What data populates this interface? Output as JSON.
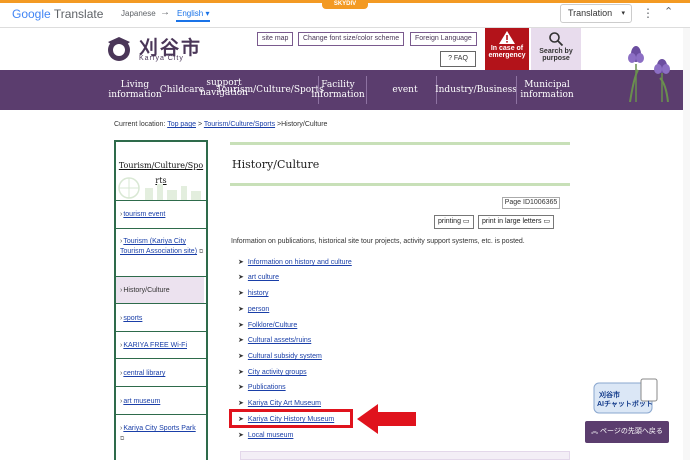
{
  "translate_bar": {
    "brand": "Google",
    "product": "Translate",
    "source_lang": "Japanese",
    "target_lang": "English",
    "mode": "Translation",
    "banner": "SKYDIV"
  },
  "header": {
    "city_name": "刈谷市",
    "city_name_en": "Kariya City",
    "links": [
      "site map",
      "Change font size/color scheme",
      "Foreign Language"
    ],
    "faq": "FAQ",
    "emergency": [
      "In case of",
      "emergency"
    ],
    "search_purpose": [
      "Search by",
      "purpose"
    ]
  },
  "nav": {
    "items": [
      [
        "Living",
        "information"
      ],
      [
        "Childcare"
      ],
      [
        "support",
        "navigation"
      ],
      [
        "Tourism/Culture/Sports"
      ],
      [
        "Facility",
        "information"
      ],
      [
        "event"
      ],
      [
        "Industry/Business"
      ],
      [
        "Municipal",
        "information"
      ]
    ]
  },
  "breadcrumb": {
    "label": "Current location:",
    "home": "Top page",
    "section": "Tourism/Culture/Sports",
    "current": "History/Culture"
  },
  "sidebar": {
    "title": [
      "Tourism/Culture/Spo",
      "rts"
    ],
    "items": [
      "tourism event",
      "Tourism (Kariya City Tourism Association site)",
      "History/Culture",
      "sports",
      "KARIYA FREE Wi-Fi",
      "central library",
      "art museum",
      "Kariya City Sports Park"
    ]
  },
  "main": {
    "title": "History/Culture",
    "page_id": "Page ID1006365",
    "printing": "printing",
    "print_large": "print in large letters",
    "intro": "Information on publications, historical site tour projects, activity support systems, etc. is posted.",
    "links": [
      "Information on history and culture",
      "art culture",
      "history",
      "person",
      "Folklore/Culture",
      "Cultural assets/ruins",
      "Cultural subsidy system",
      "City activity groups",
      "Publications",
      "Kariya City Art Museum",
      "Kariya City History Museum",
      "Local museum"
    ]
  },
  "widgets": {
    "chatbot_city": "刈谷市",
    "chatbot_label": "AIチャットボット",
    "back_to_top": "ページの先頭へ戻る"
  },
  "colors": {
    "brand_purple": "#5b3d6e",
    "sidebar_green": "#2e6b4b",
    "emergency_red": "#b3131a",
    "highlight_red": "#e0131d",
    "link_blue": "#1a3fa8"
  }
}
